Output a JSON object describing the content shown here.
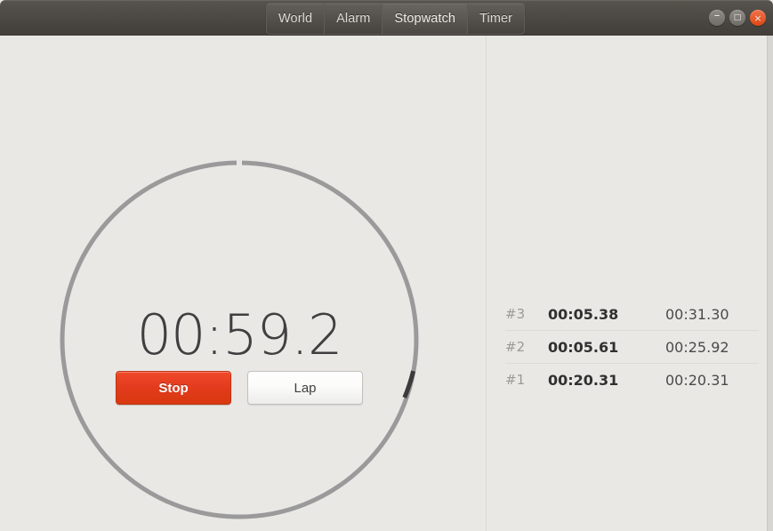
{
  "window": {
    "controls": [
      {
        "name": "minimize",
        "glyph": "–"
      },
      {
        "name": "maximize",
        "glyph": "□"
      },
      {
        "name": "close",
        "glyph": "×"
      }
    ]
  },
  "tabs": [
    {
      "label": "World",
      "active": false
    },
    {
      "label": "Alarm",
      "active": false
    },
    {
      "label": "Stopwatch",
      "active": true
    },
    {
      "label": "Timer",
      "active": false
    }
  ],
  "stopwatch": {
    "elapsed": "00:59.2",
    "progress_fraction": 0.987,
    "dial": {
      "track_color": "#9a9a9a",
      "progress_color": "#3b3b3b",
      "gap_color": "#e9e8e5"
    },
    "buttons": {
      "stop": "Stop",
      "lap": "Lap"
    },
    "colors": {
      "stop_button": "#e23b1d",
      "lap_button": "#fbfbfa",
      "time_text": "#3f3f3f"
    }
  },
  "laps": [
    {
      "index": "#3",
      "split": "00:05.38",
      "total": "00:31.30"
    },
    {
      "index": "#2",
      "split": "00:05.61",
      "total": "00:25.92"
    },
    {
      "index": "#1",
      "split": "00:20.31",
      "total": "00:20.31"
    }
  ]
}
